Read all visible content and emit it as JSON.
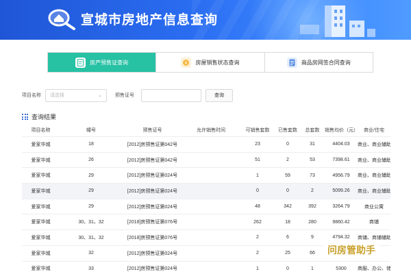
{
  "banner": {
    "title": "宣城市房地产信息查询"
  },
  "tabs": [
    {
      "label": "房产预售证查询",
      "icon": "document-icon",
      "active": true
    },
    {
      "label": "房屋销售状态查询",
      "icon": "coins-icon",
      "active": false
    },
    {
      "label": "商品房网签合同查询",
      "icon": "contract-icon",
      "active": false
    }
  ],
  "search": {
    "project_label": "项目名称",
    "project_placeholder": "请选择",
    "permit_label": "预售证号",
    "permit_value": "",
    "button": "查询"
  },
  "results": {
    "title": "查询结果",
    "columns": [
      "项目名称",
      "幢号",
      "预售证号",
      "允许销售时间",
      "可销售套数",
      "已售套数",
      "总套数",
      "销售均价（元）",
      "商业/住宅"
    ],
    "rows": [
      [
        "爱家华城",
        "18",
        "[2012]房预售证第042号",
        "",
        "23",
        "0",
        "31",
        "4404.03",
        "商业、商业辅助用房"
      ],
      [
        "爱家华城",
        "26",
        "[2012]房预售证第042号",
        "",
        "51",
        "2",
        "53",
        "7398.61",
        "商业、商业辅助用房"
      ],
      [
        "爱家华城",
        "29",
        "[2012]房预售证第024号",
        "",
        "1",
        "59",
        "73",
        "4956.79",
        "商业、商业辅助用房"
      ],
      [
        "爱家华城",
        "29",
        "[2012]房预售证第024号",
        "",
        "0",
        "0",
        "2",
        "5099.26",
        "商业、商业辅助用..."
      ],
      [
        "爱家华城",
        "29",
        "[2012]房预售证第024号",
        "",
        "48",
        "342",
        "392",
        "3264.79",
        "商业公寓"
      ],
      [
        "爱家华城",
        "30、31、32",
        "[2018]房预售证第076号",
        "",
        "262",
        "18",
        "280",
        "9860.42",
        "商铺"
      ],
      [
        "爱家华城",
        "30、31、32",
        "[2018]房预售证第076号",
        "",
        "2",
        "6",
        "9",
        "4794.32",
        "商铺、商铺辅助用房"
      ],
      [
        "爱家华城",
        "32",
        "[2012]房预售证第024号",
        "",
        "2",
        "25",
        "66",
        "1773.9",
        ""
      ],
      [
        "爱家华城",
        "33",
        "[2012]房预售证第024号",
        "",
        "1",
        "0",
        "1",
        "5300",
        "商服、办公、储藏"
      ]
    ]
  },
  "watermark": {
    "text": "问房管助手"
  },
  "colors": {
    "banner": "#2a6cf0",
    "active_tab": "#27c1a4",
    "accent": "#3b6fd8"
  }
}
